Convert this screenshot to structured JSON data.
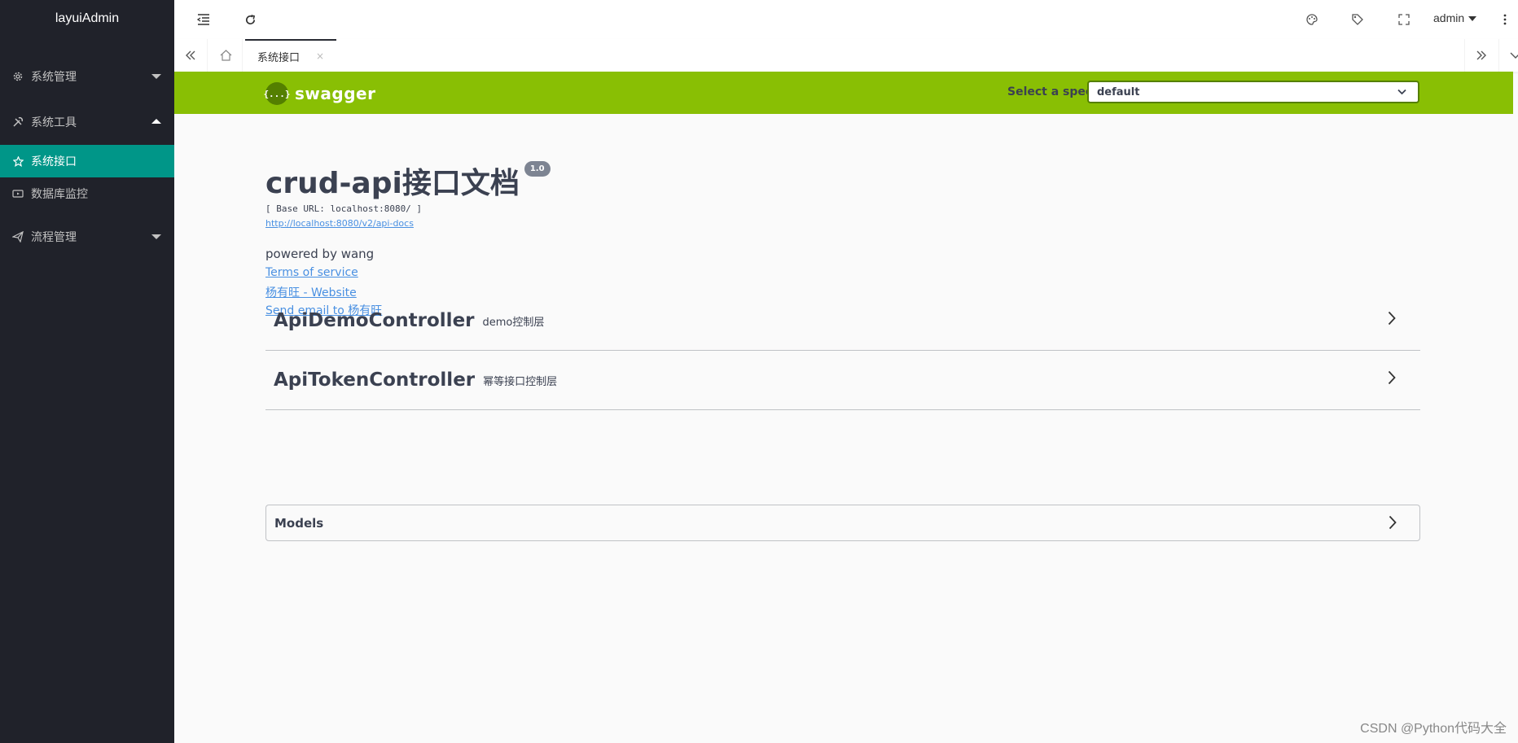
{
  "app": {
    "logo": "layuiAdmin"
  },
  "sidebar": {
    "items": [
      {
        "label": "系统管理",
        "icon": "gear-icon",
        "expanded": false
      },
      {
        "label": "系统工具",
        "icon": "tools-icon",
        "expanded": true,
        "children": [
          {
            "label": "系统接口",
            "icon": "star-icon",
            "active": true
          },
          {
            "label": "数据库监控",
            "icon": "video-icon",
            "active": false
          }
        ]
      },
      {
        "label": "流程管理",
        "icon": "paper-plane-icon",
        "expanded": false
      }
    ]
  },
  "header": {
    "user": "admin",
    "icons": [
      "menu-fold-icon",
      "refresh-icon",
      "theme-icon",
      "tag-icon",
      "fullscreen-icon",
      "more-icon"
    ]
  },
  "tabs": {
    "items": [
      {
        "label": "系统接口",
        "close": "×"
      }
    ]
  },
  "swagger": {
    "brand": "swagger",
    "logo_glyph": "{...}",
    "spec_label": "Select a spec",
    "spec_value": "default",
    "title": "crud-api接口文档",
    "version": "1.0",
    "base_url": "[ Base URL: localhost:8080/ ]",
    "api_docs_link": "http://localhost:8080/v2/api-docs",
    "description": "powered by wang",
    "terms": "Terms of service",
    "website": "杨有旺 - Website",
    "email": "Send email to 杨有旺",
    "controllers": [
      {
        "name": "ApiDemoController",
        "desc": "demo控制层"
      },
      {
        "name": "ApiTokenController",
        "desc": "幂等接口控制层"
      }
    ],
    "models_label": "Models"
  },
  "watermark": "CSDN @Python代码大全",
  "colors": {
    "sidebar_bg": "#20222a",
    "active": "#009688",
    "swagger_green": "#89bf04",
    "link": "#4990e2"
  }
}
